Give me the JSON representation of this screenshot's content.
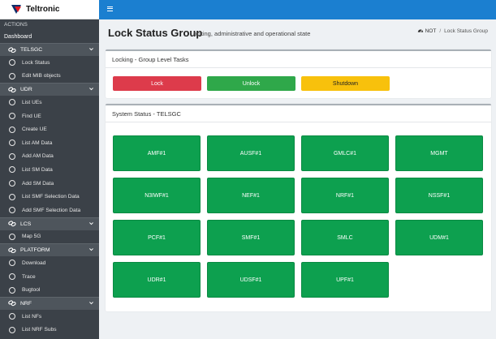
{
  "brand": {
    "name": "Teltronic"
  },
  "sidebar": {
    "actions_label": "ACTIONS",
    "dashboard_label": "Dashboard",
    "groups": [
      {
        "label": "TELSGC",
        "items": [
          "Lock Status",
          "Edit MIB objects"
        ]
      },
      {
        "label": "UDR",
        "items": [
          "List UEs",
          "Find UE",
          "Create UE",
          "List AM Data",
          "Add AM Data",
          "List SM Data",
          "Add SM Data",
          "List SMF Selection Data",
          "Add SMF Selection Data"
        ]
      },
      {
        "label": "LCS",
        "items": [
          "Map 5G"
        ]
      },
      {
        "label": "PLATFORM",
        "items": [
          "Download",
          "Trace",
          "Bugtool"
        ]
      },
      {
        "label": "NRF",
        "items": [
          "List NFs",
          "List NRF Subs"
        ]
      }
    ]
  },
  "header": {
    "title": "Lock Status Group",
    "subtitle": "Locking, administrative and operational state",
    "breadcrumb": {
      "root": "NOT",
      "separator": "/",
      "current": "Lock Status Group"
    }
  },
  "tasks_card": {
    "title": "Locking - Group Level Tasks",
    "buttons": {
      "lock": "Lock",
      "unlock": "Unlock",
      "shutdown": "Shutdown"
    }
  },
  "status_card": {
    "title": "System Status - TELSGC",
    "tiles": [
      "AMF#1",
      "AUSF#1",
      "GMLC#1",
      "MGMT",
      "N3IWF#1",
      "NEF#1",
      "NRF#1",
      "NSSF#1",
      "PCF#1",
      "SMF#1",
      "SMLC",
      "UDM#1",
      "UDR#1",
      "UDSF#1",
      "UPF#1"
    ]
  },
  "colors": {
    "topbar": "#1b7fd0",
    "sidebar": "#3b4148",
    "lock": "#dd3b4b",
    "unlock": "#2fa84a",
    "shutdown": "#f8c10c",
    "tile_ok": "#0da04f"
  },
  "icons": {
    "menu": "hamburger-icon",
    "group": "link-icon",
    "group_toggle": "chevron-down-icon",
    "item": "circle-icon",
    "breadcrumb_home": "dashboard-icon"
  }
}
